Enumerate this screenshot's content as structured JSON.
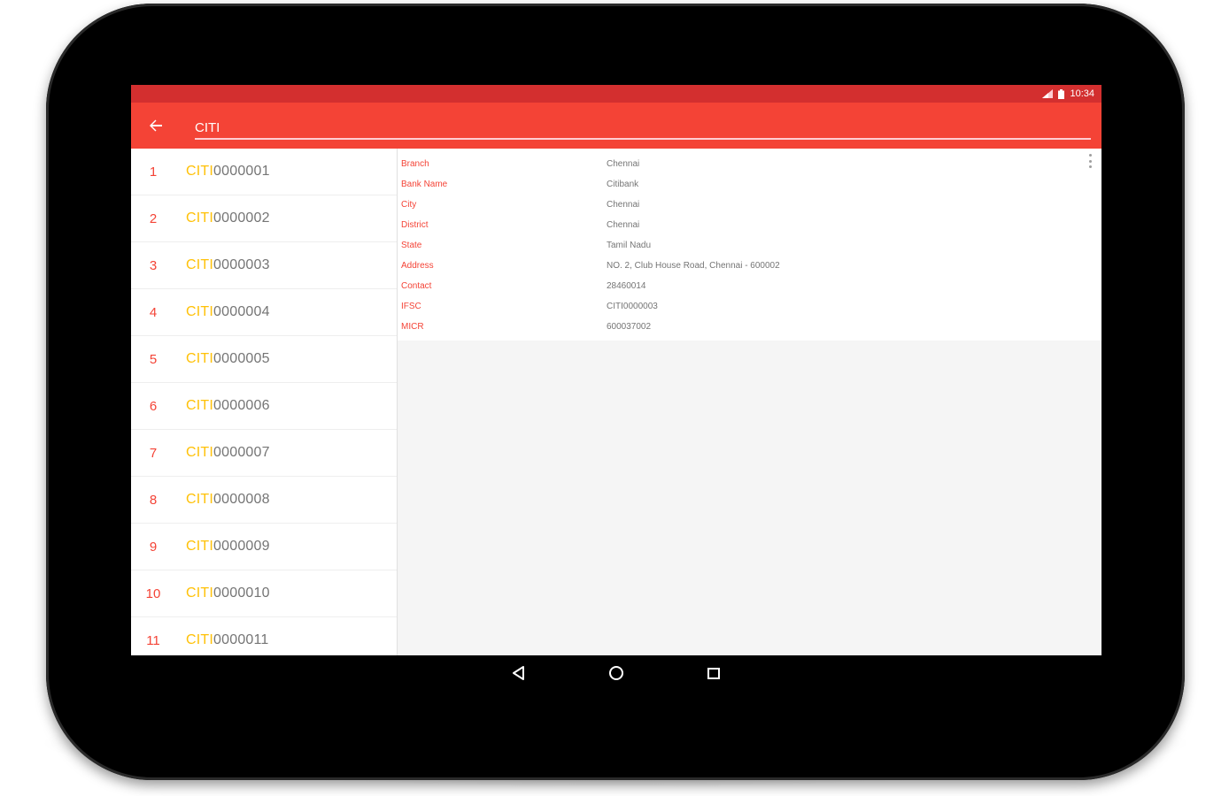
{
  "status_bar": {
    "time": "10:34"
  },
  "toolbar": {
    "search_value": "CITI"
  },
  "list": [
    {
      "num": "1",
      "prefix": "CITI",
      "rest": "0000001"
    },
    {
      "num": "2",
      "prefix": "CITI",
      "rest": "0000002"
    },
    {
      "num": "3",
      "prefix": "CITI",
      "rest": "0000003"
    },
    {
      "num": "4",
      "prefix": "CITI",
      "rest": "0000004"
    },
    {
      "num": "5",
      "prefix": "CITI",
      "rest": "0000005"
    },
    {
      "num": "6",
      "prefix": "CITI",
      "rest": "0000006"
    },
    {
      "num": "7",
      "prefix": "CITI",
      "rest": "0000007"
    },
    {
      "num": "8",
      "prefix": "CITI",
      "rest": "0000008"
    },
    {
      "num": "9",
      "prefix": "CITI",
      "rest": "0000009"
    },
    {
      "num": "10",
      "prefix": "CITI",
      "rest": "0000010"
    },
    {
      "num": "11",
      "prefix": "CITI",
      "rest": "0000011"
    }
  ],
  "details": [
    {
      "label": "Branch",
      "value": "Chennai"
    },
    {
      "label": "Bank Name",
      "value": "Citibank"
    },
    {
      "label": "City",
      "value": "Chennai"
    },
    {
      "label": "District",
      "value": "Chennai"
    },
    {
      "label": "State",
      "value": "Tamil Nadu"
    },
    {
      "label": "Address",
      "value": "NO. 2, Club House Road, Chennai - 600002"
    },
    {
      "label": "Contact",
      "value": "28460014"
    },
    {
      "label": "IFSC",
      "value": "CITI0000003"
    },
    {
      "label": "MICR",
      "value": "600037002"
    }
  ],
  "icons": {
    "back": "arrow-left-icon",
    "overflow": "more-vert-icon",
    "nav_back": "triangle-back-icon",
    "nav_home": "circle-home-icon",
    "nav_recents": "square-recents-icon"
  },
  "colors": {
    "status_bar": "#d32f2f",
    "toolbar": "#f44336",
    "prefix": "#ffc107",
    "label": "#f44336",
    "value": "#757575"
  }
}
